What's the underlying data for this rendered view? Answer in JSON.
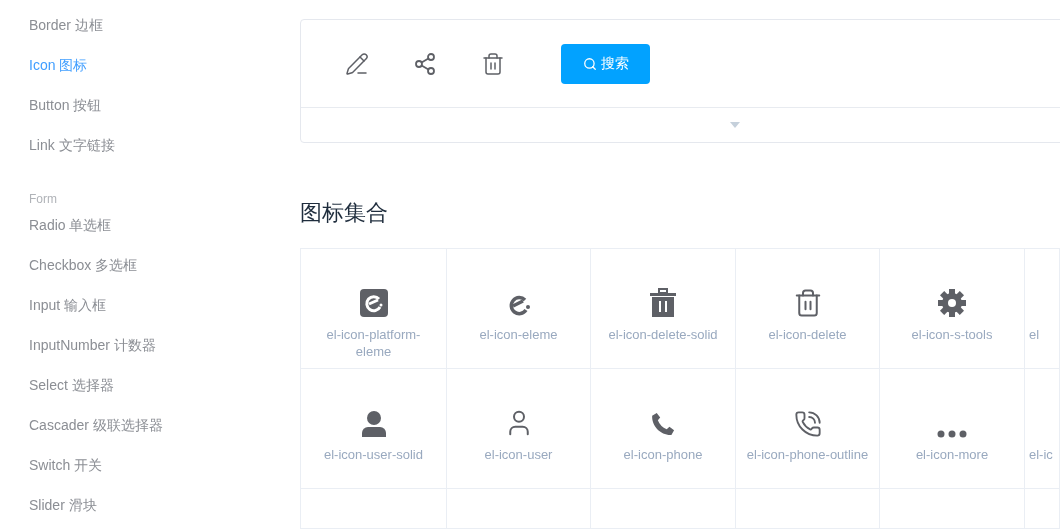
{
  "sidebar": {
    "items": [
      {
        "kind": "link",
        "label": "Border 边框",
        "selected": false
      },
      {
        "kind": "link",
        "label": "Icon 图标",
        "selected": true
      },
      {
        "kind": "link",
        "label": "Button 按钮",
        "selected": false
      },
      {
        "kind": "link",
        "label": "Link 文字链接",
        "selected": false
      },
      {
        "kind": "heading",
        "label": "Form"
      },
      {
        "kind": "link",
        "label": "Radio 单选框",
        "selected": false
      },
      {
        "kind": "link",
        "label": "Checkbox 多选框",
        "selected": false
      },
      {
        "kind": "link",
        "label": "Input 输入框",
        "selected": false
      },
      {
        "kind": "link",
        "label": "InputNumber 计数器",
        "selected": false
      },
      {
        "kind": "link",
        "label": "Select 选择器",
        "selected": false
      },
      {
        "kind": "link",
        "label": "Cascader 级联选择器",
        "selected": false
      },
      {
        "kind": "link",
        "label": "Switch 开关",
        "selected": false
      },
      {
        "kind": "link",
        "label": "Slider 滑块",
        "selected": false
      }
    ]
  },
  "demo": {
    "search_button": "搜索"
  },
  "icon_grid": {
    "title": "图标集合",
    "rows": [
      [
        "el-icon-platform-eleme",
        "el-icon-eleme",
        "el-icon-delete-solid",
        "el-icon-delete",
        "el-icon-s-tools",
        "el"
      ],
      [
        "el-icon-user-solid",
        "el-icon-user",
        "el-icon-phone",
        "el-icon-phone-outline",
        "el-icon-more",
        "el-ic"
      ]
    ]
  }
}
